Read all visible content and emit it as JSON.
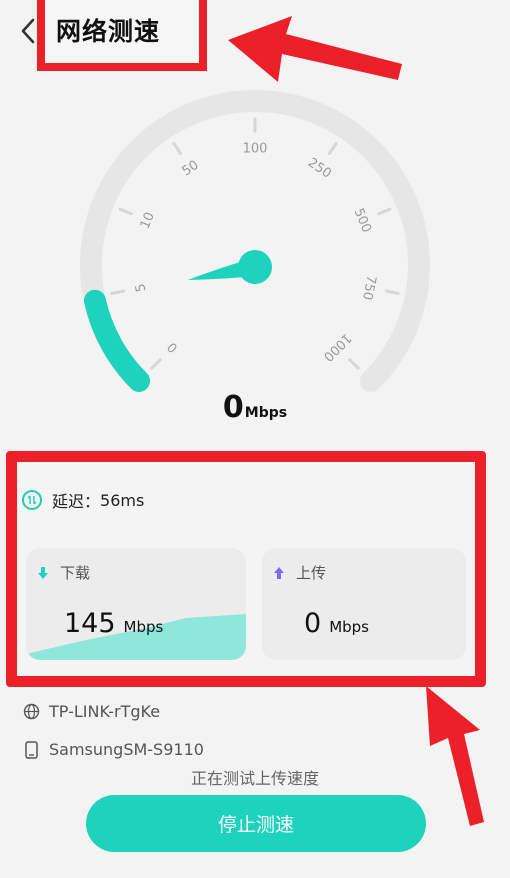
{
  "header": {
    "title": "网络测速"
  },
  "gauge": {
    "ticks": [
      "0",
      "5",
      "10",
      "50",
      "100",
      "250",
      "500",
      "750",
      "1000"
    ],
    "speed_value": "0",
    "speed_unit": "Mbps",
    "progress_fraction": 0.12
  },
  "results": {
    "latency_label": "延迟：",
    "latency_value": "56ms",
    "download": {
      "label": "下载",
      "value": "145",
      "unit": "Mbps"
    },
    "upload": {
      "label": "上传",
      "value": "0",
      "unit": "Mbps"
    }
  },
  "device": {
    "wifi_name": "TP-LINK-rTgKe",
    "phone_model": "SamsungSM-S9110"
  },
  "status_text": "正在测试上传速度",
  "stop_button": "停止测速",
  "colors": {
    "accent": "#1ed3bd",
    "highlight": "#ec2028",
    "track": "#e6e6e6"
  }
}
